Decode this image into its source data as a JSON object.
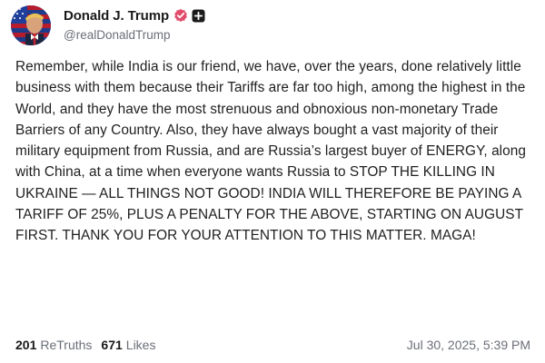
{
  "post": {
    "author": {
      "display_name": "Donald J. Trump",
      "handle": "@realDonaldTrump",
      "verified_icon": "verified-badge-icon",
      "verified_color": "#e24b6b",
      "action_icon": "add-icon"
    },
    "body": "Remember, while India is our friend, we have, over the years, done relatively little business with them because their Tariffs are far too high, among the highest in the World, and they have the most strenuous and obnoxious non-monetary Trade Barriers of any Country. Also, they have always bought a vast majority of their military equipment from Russia, and are Russia’s largest buyer of ENERGY, along with China, at a time when everyone wants Russia to STOP THE KILLING IN UKRAINE — ALL THINGS NOT GOOD! INDIA WILL THEREFORE BE PAYING A TARIFF OF 25%, PLUS A PENALTY FOR THE ABOVE, STARTING ON AUGUST FIRST. THANK YOU FOR YOUR ATTENTION TO THIS MATTER. MAGA!",
    "stats": {
      "retruths_count": "201",
      "retruths_label": "ReTruths",
      "likes_count": "671",
      "likes_label": "Likes"
    },
    "timestamp": "Jul 30, 2025, 5:39 PM"
  }
}
